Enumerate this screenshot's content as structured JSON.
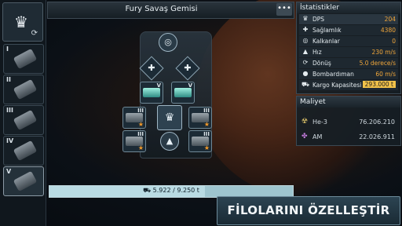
{
  "header": {
    "title": "Fury Savaş Gemisi",
    "menu_label": "•••"
  },
  "left_panel": {
    "slots": [
      {
        "label": "I"
      },
      {
        "label": "II"
      },
      {
        "label": "III"
      },
      {
        "label": "IV"
      },
      {
        "label": "V"
      }
    ]
  },
  "ship": {
    "turret_levels": [
      "V",
      "V",
      "III",
      "III",
      "III",
      "III"
    ]
  },
  "cargo_bar": {
    "text": "5.922 / 9.250 t",
    "fraction": 0.64
  },
  "stats": {
    "title": "İstatistikler",
    "rows": [
      {
        "icon": "crown",
        "label": "DPS",
        "value": "204"
      },
      {
        "icon": "cross",
        "label": "Sağlamlık",
        "value": "4380"
      },
      {
        "icon": "globe",
        "label": "Kalkanlar",
        "value": "0"
      },
      {
        "icon": "arrow-up",
        "label": "Hız",
        "value": "230 m/s"
      },
      {
        "icon": "rotate",
        "label": "Dönüş",
        "value": "5.0 derece/s"
      },
      {
        "icon": "bomb",
        "label": "Bombardıman",
        "value": "60 m/s"
      },
      {
        "icon": "cargo",
        "label": "Kargo Kapasitesi",
        "value": "293.000 t"
      }
    ]
  },
  "cost": {
    "title": "Maliyet",
    "rows": [
      {
        "icon": "he3",
        "label": "He-3",
        "value": "76.206.210"
      },
      {
        "icon": "am",
        "label": "AM",
        "value": "22.026.911"
      }
    ]
  },
  "cta": {
    "label": "FİLOLARINI ÖZELLEŞTİR"
  },
  "colors": {
    "accent": "#f0a63a",
    "cargo_highlight": "#f1c24a",
    "bar": "#9ec5cf"
  }
}
